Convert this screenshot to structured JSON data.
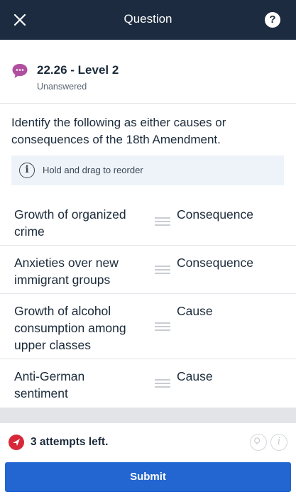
{
  "header": {
    "title": "Question",
    "help_label": "?",
    "close_icon": "close-icon",
    "help_icon": "question-circle-icon"
  },
  "question": {
    "level": "22.26 - Level 2",
    "status": "Unanswered",
    "chat_icon": "chat-bubble-icon",
    "chat_icon_color": "#b04fa0",
    "prompt": "Identify the following as either causes or consequences of the 18th Amendment."
  },
  "hint": {
    "icon_label": "i",
    "text": "Hold and drag to reorder"
  },
  "items": [
    {
      "item": "Growth of organized crime",
      "answer": "Consequence"
    },
    {
      "item": "Anxieties over new immigrant groups",
      "answer": "Consequence"
    },
    {
      "item": "Growth of alcohol consumption among upper classes",
      "answer": "Cause"
    },
    {
      "item": "Anti-German sentiment",
      "answer": "Cause"
    }
  ],
  "footer": {
    "attempts": "3 attempts left.",
    "attempts_icon": "paper-plane-icon",
    "info_label": "i",
    "submit_label": "Submit",
    "accent_color": "#2366d1",
    "alert_color": "#d7283a"
  }
}
